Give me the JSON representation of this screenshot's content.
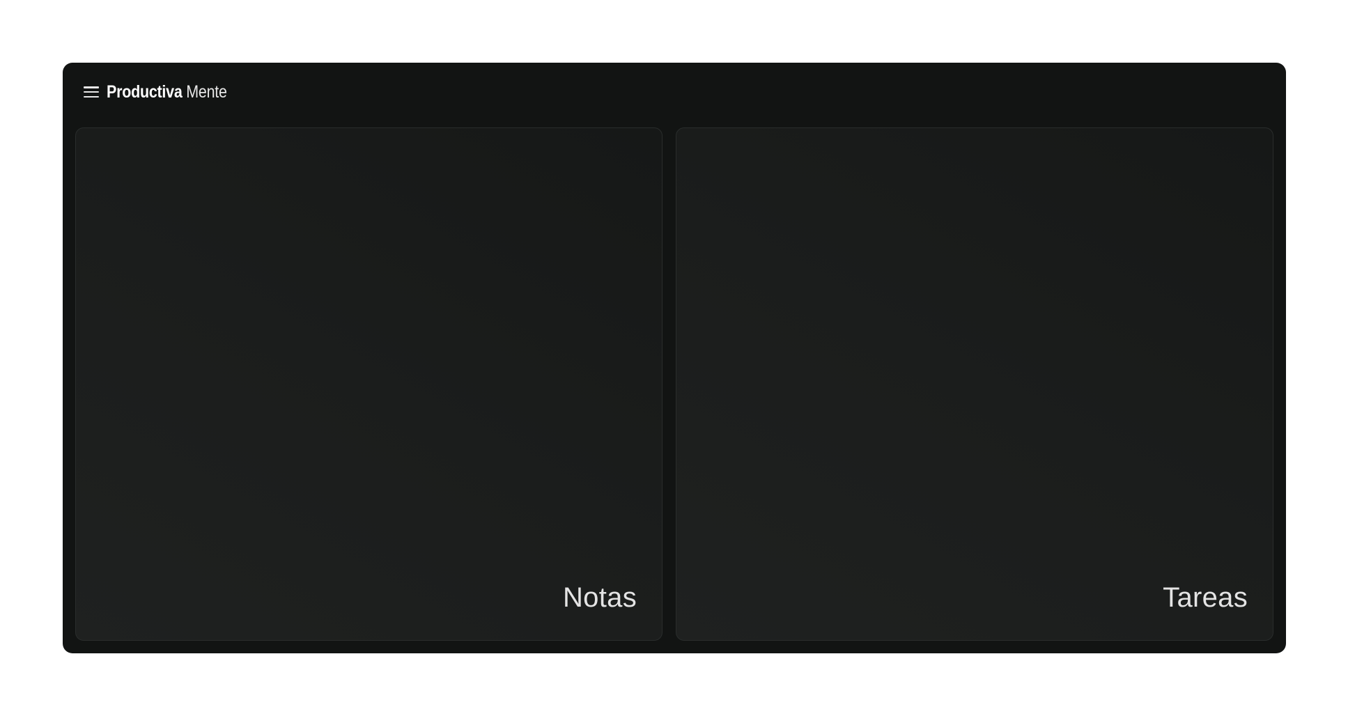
{
  "header": {
    "menu_icon": "hamburger-menu-icon",
    "brand_bold": "Productiva",
    "brand_light": " Mente"
  },
  "panels": [
    {
      "label": "Notas"
    },
    {
      "label": "Tareas"
    }
  ],
  "colors": {
    "page_background": "#ffffff",
    "window_background": "#121413",
    "panel_border": "#2a2d2c",
    "text": "#e4e4e4"
  }
}
